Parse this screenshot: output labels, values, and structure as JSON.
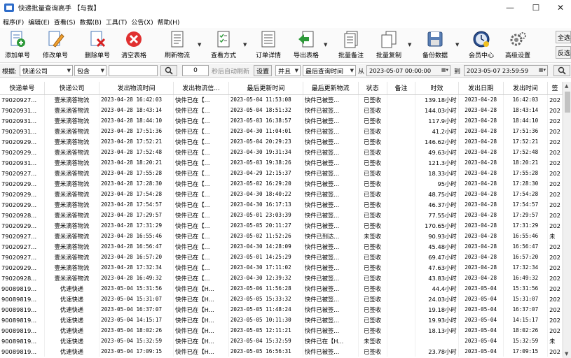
{
  "window": {
    "title": "快递批量查询高手 【与我】"
  },
  "menu": [
    "程序(F)",
    "编辑(E)",
    "查看(S)",
    "数据(B)",
    "工具(T)",
    "公告(X)",
    "帮助(H)"
  ],
  "toolbar": {
    "add": "添加单号",
    "edit": "修改单号",
    "delete": "删除单号",
    "clear": "清空表格",
    "refresh": "刷新物流",
    "view_mode": "查看方式",
    "order_detail": "订单详情",
    "export": "导出表格",
    "batch_note": "批量备注",
    "batch_copy": "批量复制",
    "backup": "备份数据",
    "member": "会员中心",
    "advanced": "高级设置",
    "select_all": "全选",
    "invert": "反选"
  },
  "filter": {
    "by_label": "根据:",
    "field": "快递公司",
    "op": "包含",
    "keyword": "",
    "seconds": "0",
    "auto_refresh_label": "秒后自动刷新",
    "settings": "设置",
    "logic": "并且",
    "time_field": "最后查询时间",
    "from_label": "从",
    "from": "2023-05-07 00:00:00",
    "to_label": "到",
    "to": "2023-05-07 23:59:59"
  },
  "table": {
    "columns": [
      "快递单号",
      "快递公司",
      "发出物流时间",
      "发出物流信...",
      "最后更新时间",
      "最后更新物流",
      "状态",
      "备注",
      "时效",
      "发出日期",
      "发出时间",
      "签"
    ],
    "rows": [
      [
        "79020927...",
        "壹米滴答物流",
        "2023-04-28 16:42:03",
        "快件已在【...",
        "2023-05-04 11:53:08",
        "快件已被签...",
        "已签收",
        "",
        "139.18小时",
        "2023-04-28",
        "16:42:03",
        "202"
      ],
      [
        "79020931...",
        "壹米滴答物流",
        "2023-04-28 18:43:14",
        "快件已在【...",
        "2023-05-04 18:51:32",
        "快件已被签...",
        "已签收",
        "",
        "144.03小时",
        "2023-04-28",
        "18:43:14",
        "202"
      ],
      [
        "79020931...",
        "壹米滴答物流",
        "2023-04-28 18:44:10",
        "快件已在【...",
        "2023-05-03 16:38:57",
        "快件已被签...",
        "已签收",
        "",
        "117.9小时",
        "2023-04-28",
        "18:44:10",
        "202"
      ],
      [
        "79020931...",
        "壹米滴答物流",
        "2023-04-28 17:51:36",
        "快件已在【...",
        "2023-04-30 11:04:01",
        "快件已被签...",
        "已签收",
        "",
        "41.2小时",
        "2023-04-28",
        "17:51:36",
        "202"
      ],
      [
        "79020929...",
        "壹米滴答物流",
        "2023-04-28 17:52:21",
        "快件已在【...",
        "2023-05-04 20:29:23",
        "快件已被签...",
        "已签收",
        "",
        "146.62小时",
        "2023-04-28",
        "17:52:21",
        "202"
      ],
      [
        "79020929...",
        "壹米滴答物流",
        "2023-04-28 17:52:48",
        "快件已在【...",
        "2023-04-30 19:31:34",
        "快件已被签...",
        "已签收",
        "",
        "49.63小时",
        "2023-04-28",
        "17:52:48",
        "202"
      ],
      [
        "79020931...",
        "壹米滴答物流",
        "2023-04-28 18:20:21",
        "快件已在【...",
        "2023-05-03 19:38:26",
        "快件已被签...",
        "已签收",
        "",
        "121.3小时",
        "2023-04-28",
        "18:20:21",
        "202"
      ],
      [
        "79020927...",
        "壹米滴答物流",
        "2023-04-28 17:55:28",
        "快件已在【...",
        "2023-04-29 12:15:37",
        "快件已被签...",
        "已签收",
        "",
        "18.33小时",
        "2023-04-28",
        "17:55:28",
        "202"
      ],
      [
        "79020929...",
        "壹米滴答物流",
        "2023-04-28 17:28:30",
        "快件已在【...",
        "2023-05-02 16:29:20",
        "快件已被签...",
        "已签收",
        "",
        "95小时",
        "2023-04-28",
        "17:28:30",
        "202"
      ],
      [
        "79020929...",
        "壹米滴答物流",
        "2023-04-28 17:54:28",
        "快件已在【...",
        "2023-04-30 18:40:22",
        "快件已被签...",
        "已签收",
        "",
        "48.75小时",
        "2023-04-28",
        "17:54:28",
        "202"
      ],
      [
        "79020929...",
        "壹米滴答物流",
        "2023-04-28 17:54:57",
        "快件已在【...",
        "2023-04-30 16:17:13",
        "快件已被签...",
        "已签收",
        "",
        "46.37小时",
        "2023-04-28",
        "17:54:57",
        "202"
      ],
      [
        "79020928...",
        "壹米滴答物流",
        "2023-04-28 17:29:57",
        "快件已在【...",
        "2023-05-01 23:03:39",
        "快件已被签...",
        "已签收",
        "",
        "77.55小时",
        "2023-04-28",
        "17:29:57",
        "202"
      ],
      [
        "79020929...",
        "壹米滴答物流",
        "2023-04-28 17:31:29",
        "快件已在【...",
        "2023-05-05 20:11:27",
        "快件已被签...",
        "已签收",
        "",
        "170.65小时",
        "2023-04-28",
        "17:31:29",
        "202"
      ],
      [
        "79020927...",
        "壹米滴答物流",
        "2023-04-28 16:55:46",
        "快件已在【...",
        "2023-05-02 11:52:26",
        "快件已到达...",
        "未签收",
        "",
        "90.93小时",
        "2023-04-28",
        "16:55:46",
        "未"
      ],
      [
        "79020927...",
        "壹米滴答物流",
        "2023-04-28 16:56:47",
        "快件已在【...",
        "2023-04-30 14:28:09",
        "快件已被签...",
        "已签收",
        "",
        "45.48小时",
        "2023-04-28",
        "16:56:47",
        "202"
      ],
      [
        "79020927...",
        "壹米滴答物流",
        "2023-04-28 16:57:20",
        "快件已在【...",
        "2023-05-01 14:25:29",
        "快件已被签...",
        "已签收",
        "",
        "69.47小时",
        "2023-04-28",
        "16:57:20",
        "202"
      ],
      [
        "79020929...",
        "壹米滴答物流",
        "2023-04-28 17:32:34",
        "快件已在【...",
        "2023-04-30 17:11:02",
        "快件已被签...",
        "已签收",
        "",
        "47.63小时",
        "2023-04-28",
        "17:32:34",
        "202"
      ],
      [
        "79020928...",
        "壹米滴答物流",
        "2023-04-28 16:49:32",
        "快件已在【...",
        "2023-04-30 12:39:32",
        "快件已被签...",
        "已签收",
        "",
        "43.83小时",
        "2023-04-28",
        "16:49:32",
        "202"
      ],
      [
        "90089819...",
        "优速快递",
        "2023-05-04 15:31:56",
        "快件已在【H...",
        "2023-05-06 11:56:28",
        "快件已被签...",
        "已签收",
        "",
        "44.4小时",
        "2023-05-04",
        "15:31:56",
        "202"
      ],
      [
        "90089819...",
        "优速快递",
        "2023-05-04 15:31:07",
        "快件已在【H...",
        "2023-05-05 15:33:32",
        "快件已被签...",
        "已签收",
        "",
        "24.03小时",
        "2023-05-04",
        "15:31:07",
        "202"
      ],
      [
        "90089819...",
        "优速快递",
        "2023-05-04 16:37:07",
        "快件已在【H...",
        "2023-05-05 11:48:24",
        "快件已被签...",
        "已签收",
        "",
        "19.18小时",
        "2023-05-04",
        "16:37:07",
        "202"
      ],
      [
        "90089819...",
        "优速快递",
        "2023-05-04 14:15:17",
        "快件已在【H...",
        "2023-05-05 10:11:30",
        "快件已被签...",
        "已签收",
        "",
        "19.93小时",
        "2023-05-04",
        "14:15:17",
        "202"
      ],
      [
        "90089819...",
        "优速快递",
        "2023-05-04 18:02:26",
        "快件已在【H...",
        "2023-05-05 12:11:21",
        "快件已被签...",
        "已签收",
        "",
        "18.13小时",
        "2023-05-04",
        "18:02:26",
        "202"
      ],
      [
        "90089819...",
        "优速快递",
        "2023-05-04 15:32:59",
        "快件已在【H...",
        "2023-05-04 15:32:59",
        "快件已在【H...",
        "未签收",
        "",
        "",
        "2023-05-04",
        "15:32:59",
        "未"
      ],
      [
        "90089819...",
        "优速快递",
        "2023-05-04 17:09:15",
        "快件已在【H...",
        "2023-05-05 16:56:31",
        "快件已被签...",
        "已签收",
        "",
        "23.78小时",
        "2023-05-04",
        "17:09:15",
        "202"
      ]
    ]
  }
}
